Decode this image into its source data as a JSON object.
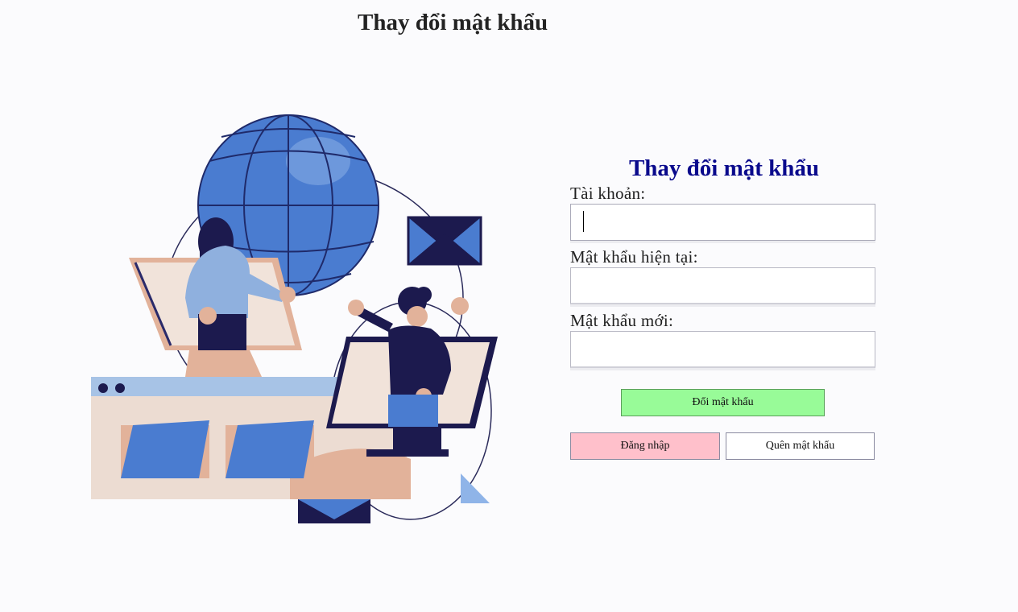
{
  "header": {
    "title": "Thay đổi mật khẩu"
  },
  "form": {
    "title": "Thay đổi mật khẩu",
    "account_label": "Tài khoản:",
    "account_value": "",
    "current_password_label": "Mật khẩu hiện tại:",
    "current_password_value": "",
    "new_password_label": "Mật khẩu mới:",
    "new_password_value": "",
    "submit_label": "Đổi mật khẩu",
    "login_label": "Đăng nhập",
    "forgot_label": "Quên mật khẩu"
  },
  "colors": {
    "form_title": "#0a0a8c",
    "submit_bg": "#98fb98",
    "login_bg": "#ffc0cb",
    "forgot_bg": "#ffffff",
    "illustration_blue": "#4a78c8",
    "illustration_navy": "#1c1a4e",
    "illustration_skin": "#e2b29a"
  },
  "illustration": {
    "icons": [
      "globe-icon",
      "envelope-icon",
      "folder-icon",
      "person-woman-icon",
      "person-man-icon",
      "browser-window-icon",
      "monitor-icon"
    ]
  }
}
